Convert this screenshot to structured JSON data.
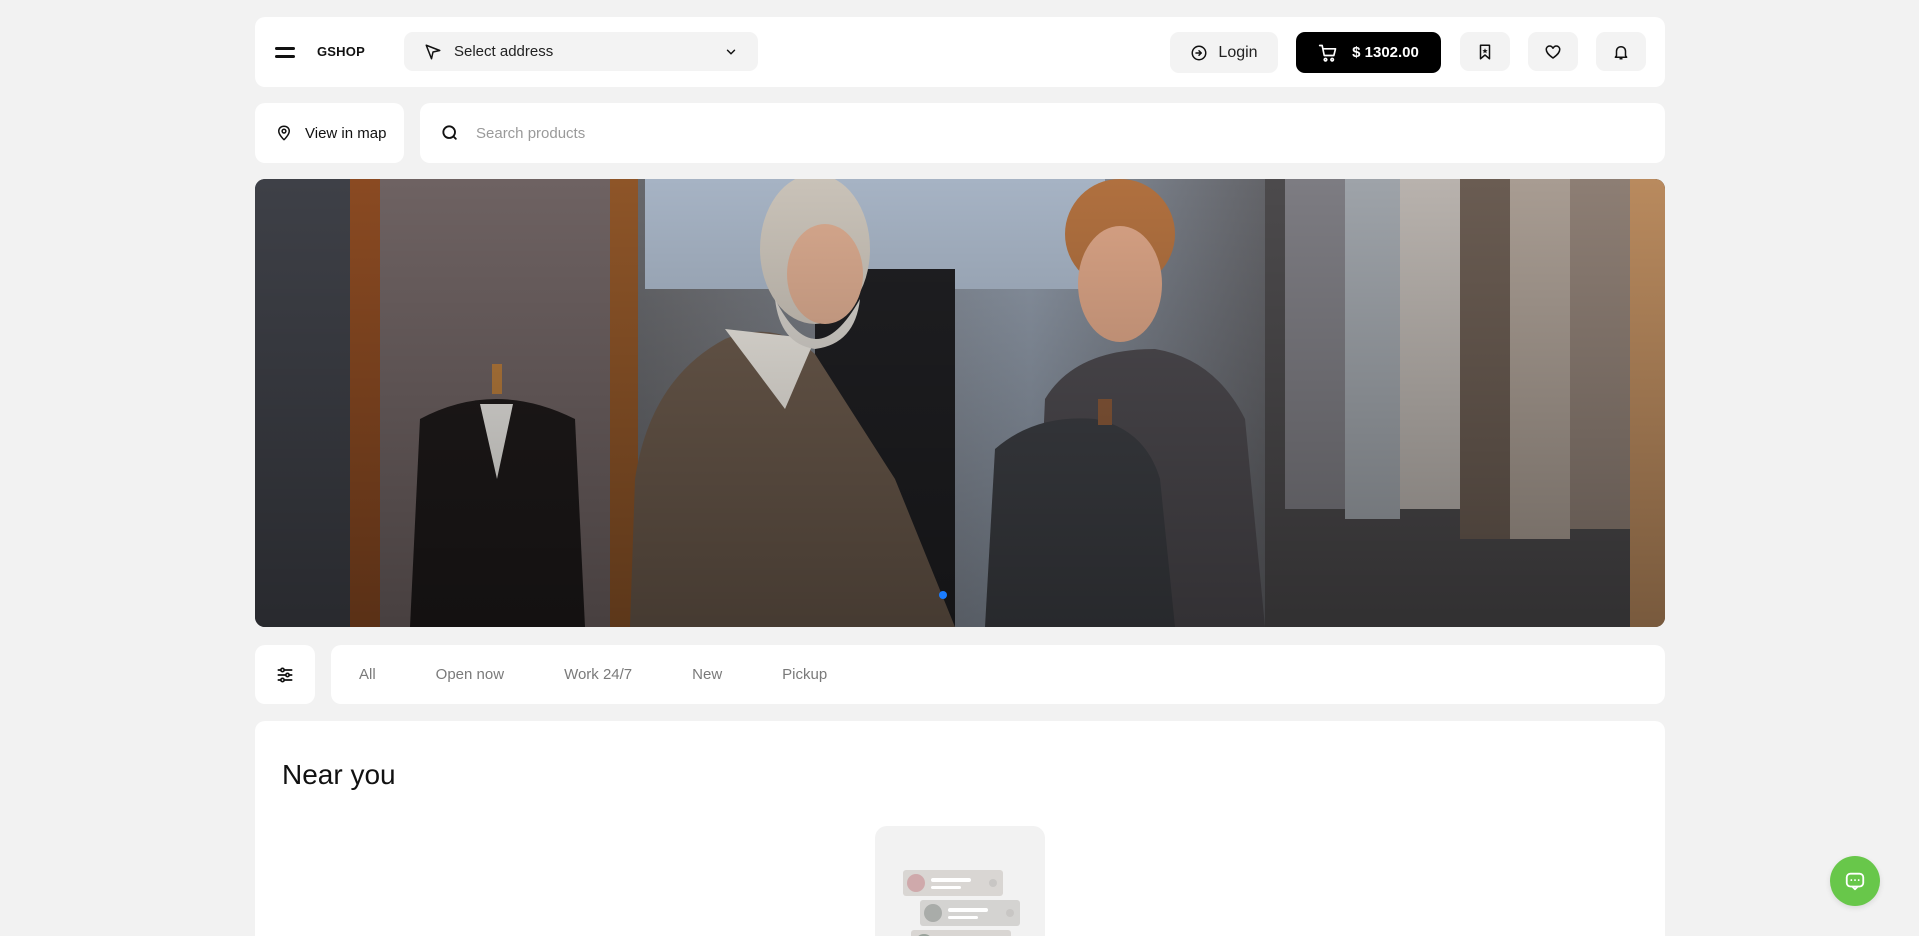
{
  "header": {
    "brand": "GSHOP",
    "address_placeholder": "Select address",
    "login_label": "Login",
    "cart_total": "$ 1302.00"
  },
  "map_button": {
    "label": "View in map"
  },
  "search": {
    "placeholder": "Search products"
  },
  "banner": {
    "slides": 1,
    "active_slide": 1
  },
  "filters": {
    "tabs": [
      {
        "label": "All"
      },
      {
        "label": "Open now"
      },
      {
        "label": "Work 24/7"
      },
      {
        "label": "New"
      },
      {
        "label": "Pickup"
      }
    ]
  },
  "near_you": {
    "title": "Near you"
  },
  "colors": {
    "accent": "#1a7cff",
    "cart_bg": "#000000",
    "chat_bg": "#68c74a",
    "page_bg": "#f2f2f2"
  },
  "icons": [
    "menu-icon",
    "navigation-arrow-icon",
    "chevron-down-icon",
    "login-icon",
    "cart-icon",
    "bookmark-icon",
    "heart-icon",
    "bell-icon",
    "location-pin-icon",
    "search-icon",
    "filter-sliders-icon",
    "chat-icon"
  ]
}
